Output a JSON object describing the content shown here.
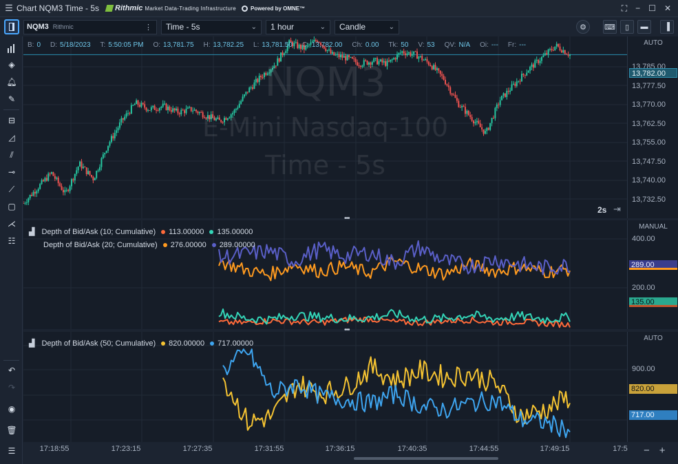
{
  "window": {
    "title": "Chart NQM3 Time - 5s",
    "brand_rithmic": "Rithmic",
    "brand_rithmic_tag": "Market Data-Trading Infrastructure",
    "brand_omne": "Powered by OMNE™"
  },
  "toolbar": {
    "symbol": "NQM3",
    "exchange": "Rithmic",
    "timeframe": "Time - 5s",
    "range": "1 hour",
    "style": "Candle"
  },
  "ohlc": [
    {
      "k": "B:",
      "v": "0"
    },
    {
      "k": "D:",
      "v": "5/18/2023"
    },
    {
      "k": "T:",
      "v": "5:50:05 PM"
    },
    {
      "k": "O:",
      "v": "13,781.75"
    },
    {
      "k": "H:",
      "v": "13,782.25"
    },
    {
      "k": "L:",
      "v": "13,781.50"
    },
    {
      "k": "C:",
      "v": "13,782.00"
    },
    {
      "k": "Ch:",
      "v": "0.00"
    },
    {
      "k": "Tk:",
      "v": "50"
    },
    {
      "k": "V:",
      "v": "53"
    },
    {
      "k": "QV:",
      "v": "N/A"
    },
    {
      "k": "Oi:",
      "v": "---"
    },
    {
      "k": "Fr:",
      "v": "---"
    }
  ],
  "watermark": {
    "symbol": "NQM3",
    "name": "E-Mini Nasdaq-100",
    "period": "Time - 5s"
  },
  "price_axis": {
    "mode": "AUTO",
    "ticks": [
      "13,785.00",
      "13,777.50",
      "13,770.00",
      "13,762.50",
      "13,755.00",
      "13,747.50",
      "13,740.00",
      "13,732.50"
    ],
    "last_price": "13,782.00",
    "interval_badge": "2s"
  },
  "pane2": {
    "mode": "MANUAL",
    "ticks": [
      "400.00",
      "200.00"
    ],
    "legend1": {
      "name": "Depth of Bid/Ask (10; Cumulative)",
      "bid": "113.00000",
      "ask": "135.00000"
    },
    "legend2": {
      "name": "Depth of Bid/Ask (20; Cumulative)",
      "bid": "276.00000",
      "ask": "289.00000"
    },
    "tag_289": "289.00",
    "tag_135": "135.00"
  },
  "pane3": {
    "mode": "AUTO",
    "ticks": [
      "900.00"
    ],
    "legend": {
      "name": "Depth of Bid/Ask (50; Cumulative)",
      "bid": "820.00000",
      "ask": "717.00000"
    },
    "tag_820": "820.00",
    "tag_717": "717.00"
  },
  "time_axis": [
    "17:18:55",
    "17:23:15",
    "17:27:35",
    "17:31:55",
    "17:36:15",
    "17:40:35",
    "17:44:55",
    "17:49:15",
    "17:5"
  ],
  "colors": {
    "bull": "#26c6a0",
    "bear": "#ef5350",
    "orange": "#ff9a1f",
    "teal": "#34d6b8",
    "red_orange": "#ff6a3a",
    "indigo": "#5a5fc8",
    "yellow": "#f5c332",
    "blue": "#3ea5f0"
  },
  "chart_data": [
    {
      "type": "candlestick",
      "title": "NQM3",
      "xlabel": "",
      "ylabel": "",
      "ylim": [
        13728,
        13788
      ],
      "x_ticks": [
        "17:18:55",
        "17:23:15",
        "17:27:35",
        "17:31:55",
        "17:36:15",
        "17:40:35",
        "17:44:55",
        "17:49:15"
      ],
      "close_path": [
        13733,
        13738,
        13743,
        13736,
        13746,
        13741,
        13752,
        13760,
        13766,
        13764,
        13765,
        13763,
        13764,
        13762,
        13760,
        13763,
        13770,
        13775,
        13779,
        13786,
        13784,
        13787,
        13782,
        13781,
        13779,
        13780,
        13779,
        13783,
        13782,
        13779,
        13774,
        13766,
        13761,
        13756,
        13767,
        13772,
        13777,
        13781,
        13785,
        13782
      ]
    },
    {
      "type": "line",
      "title": "",
      "xlabel": "",
      "ylabel": "",
      "ylim": [
        100,
        420
      ],
      "series": [
        {
          "name": "Depth of Bid/Ask (10; Cumulative)",
          "values": [
            120,
            118,
            125,
            122,
            119,
            126,
            130,
            121,
            118,
            124,
            127,
            119,
            122,
            116,
            113
          ]
        },
        {
          "name": "Depth of Bid/Ask (10; Cumulative)",
          "values": [
            150,
            132,
            128,
            140,
            135,
            130,
            133,
            145,
            128,
            131,
            142,
            130,
            138,
            129,
            135
          ]
        },
        {
          "name": "Depth of Bid/Ask (20; Cumulative)",
          "values": [
            300,
            275,
            260,
            290,
            270,
            285,
            265,
            300,
            278,
            262,
            290,
            270,
            282,
            268,
            276
          ]
        },
        {
          "name": "Depth of Bid/Ask (20; Cumulative)",
          "values": [
            310,
            320,
            330,
            300,
            335,
            315,
            325,
            295,
            340,
            300,
            285,
            305,
            290,
            280,
            289
          ]
        }
      ]
    },
    {
      "type": "line",
      "title": "",
      "xlabel": "",
      "ylabel": "",
      "ylim": [
        680,
        1020
      ],
      "series": [
        {
          "name": "Depth of Bid/Ask (50; Cumulative)",
          "values": [
            880,
            740,
            760,
            860,
            830,
            850,
            910,
            870,
            900,
            880,
            890,
            860,
            760,
            780,
            820
          ]
        },
        {
          "name": "Depth of Bid/Ask (50; Cumulative)",
          "values": [
            900,
            960,
            830,
            860,
            820,
            810,
            800,
            830,
            790,
            780,
            800,
            810,
            750,
            740,
            717
          ]
        }
      ]
    }
  ]
}
